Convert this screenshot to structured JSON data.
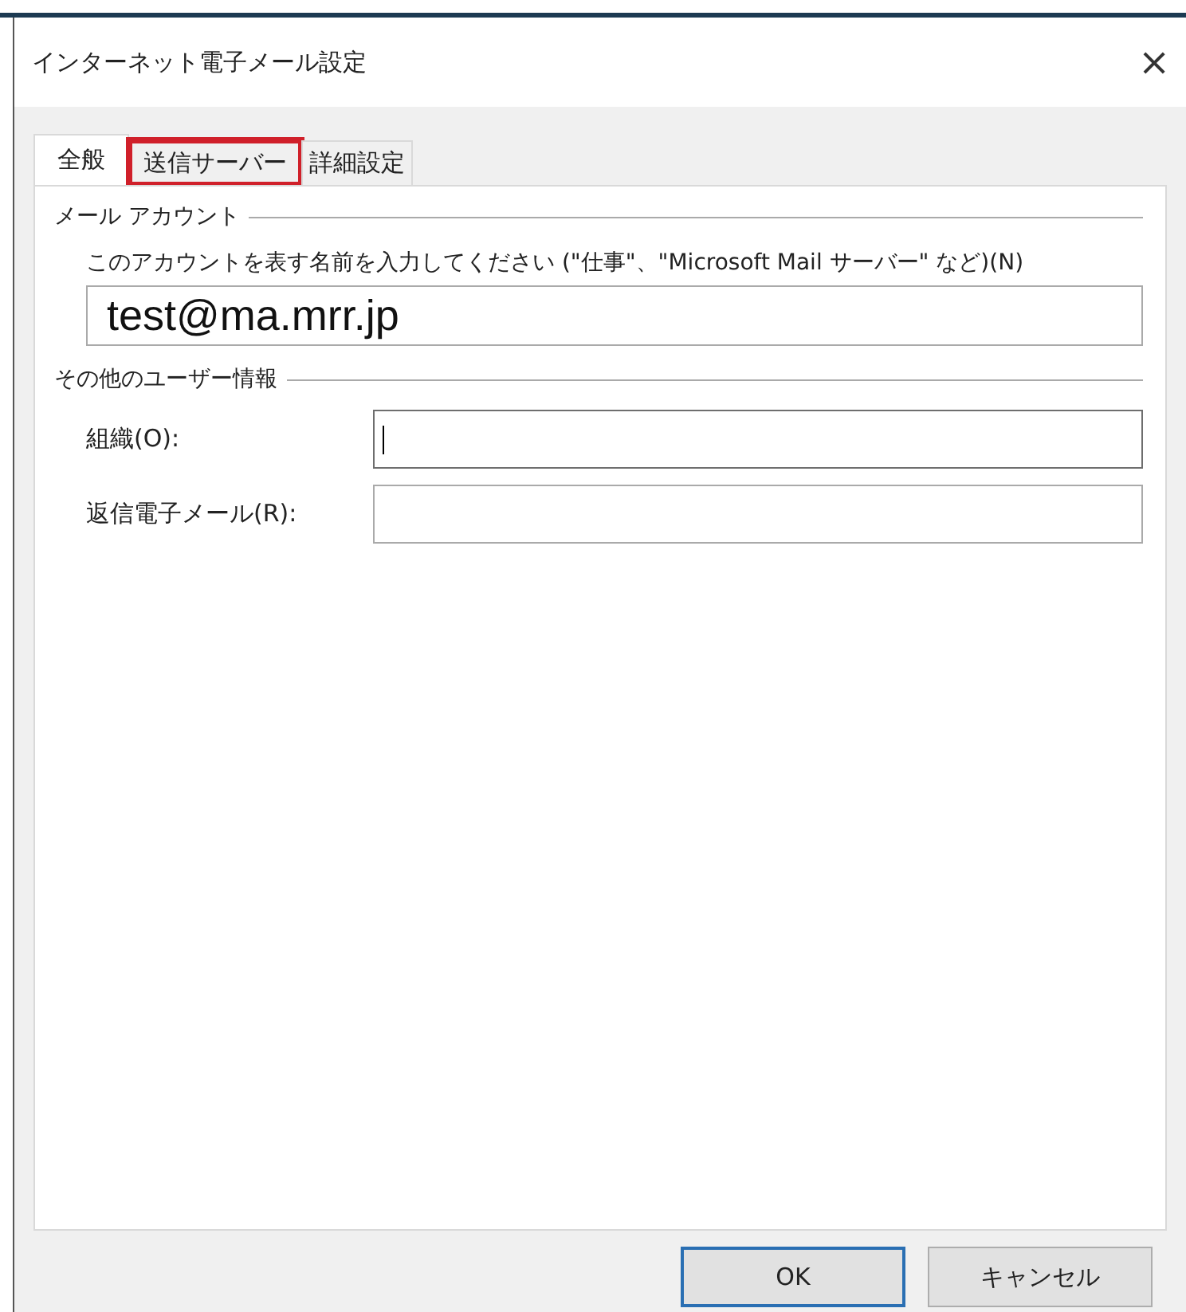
{
  "window": {
    "title": "インターネット電子メール設定",
    "close": "×"
  },
  "tabs": [
    {
      "label": "全般",
      "selected": true,
      "highlighted": false
    },
    {
      "label": "送信サーバー",
      "selected": false,
      "highlighted": true
    },
    {
      "label": "詳細設定",
      "selected": false,
      "highlighted": false
    }
  ],
  "mail_account": {
    "heading": "メール アカウント",
    "prompt": "このアカウントを表す名前を入力してください (\"仕事\"、\"Microsoft Mail サーバー\" など)(N)",
    "value": "test@ma.mrr.jp"
  },
  "other_info": {
    "heading": "その他のユーザー情報",
    "fields": [
      {
        "label": "組織(O):",
        "focused": true
      },
      {
        "label": "返信電子メール(R):",
        "focused": false
      }
    ]
  },
  "buttons": [
    {
      "label": "OK",
      "default": true
    },
    {
      "label": "キャンセル",
      "default": false
    }
  ]
}
